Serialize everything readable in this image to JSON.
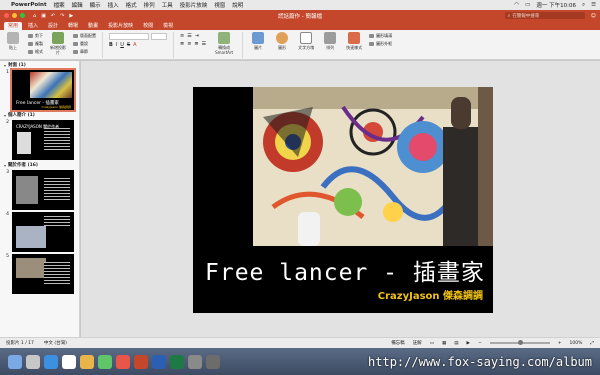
{
  "menubar": {
    "app_name": "PowerPoint",
    "items": [
      "檔案",
      "編輯",
      "顯示",
      "插入",
      "格式",
      "排列",
      "工具",
      "投影片放映",
      "視窗",
      "說明"
    ],
    "clock": "週一 下午10:06"
  },
  "titlebar": {
    "doc_title": "謊話篇作 - 簡報檔",
    "search_placeholder": "在簡報中搜尋",
    "share_label": "共用"
  },
  "tabs": [
    "常用",
    "插入",
    "設計",
    "轉場",
    "動畫",
    "投影片放映",
    "校閱",
    "檢視"
  ],
  "active_tab": "常用",
  "ribbon": {
    "paste": "貼上",
    "cut": "剪下",
    "copy": "複製",
    "format_painter": "格式",
    "new_slide": "新增投影片",
    "layout": "版面配置",
    "reset": "重設",
    "section": "章節",
    "convert_smartart": "轉換成SmartArt",
    "picture": "圖片",
    "shapes": "圖形",
    "textbox": "文字方塊",
    "arrange": "排列",
    "quick_styles": "快速樣式",
    "shape_fill": "圖形填滿",
    "shape_outline": "圖形外框"
  },
  "outline": {
    "sections": [
      {
        "title": "封面 (1)",
        "slides": [
          1
        ]
      },
      {
        "title": "個人簡介 (1)",
        "slides": [
          2
        ]
      },
      {
        "title": "關於作者 (16)",
        "slides": [
          3,
          4,
          5
        ]
      }
    ],
    "thumb1_line": "Free lancer - 插畫家",
    "thumb2_title": "CRAZYJASON 關於作者"
  },
  "slide": {
    "title": "Free lancer - 插畫家",
    "subtitle": "CrazyJason 傑森調調"
  },
  "statusbar": {
    "slide_count": "投影片 1 / 17",
    "language": "中文 (台灣)",
    "notes": "備忘稿",
    "comments": "註解",
    "zoom": "100%"
  },
  "watermark": "http://www.fox-saying.com/album",
  "colors": {
    "accent": "#c4472b",
    "subtitle": "#f2c312"
  }
}
